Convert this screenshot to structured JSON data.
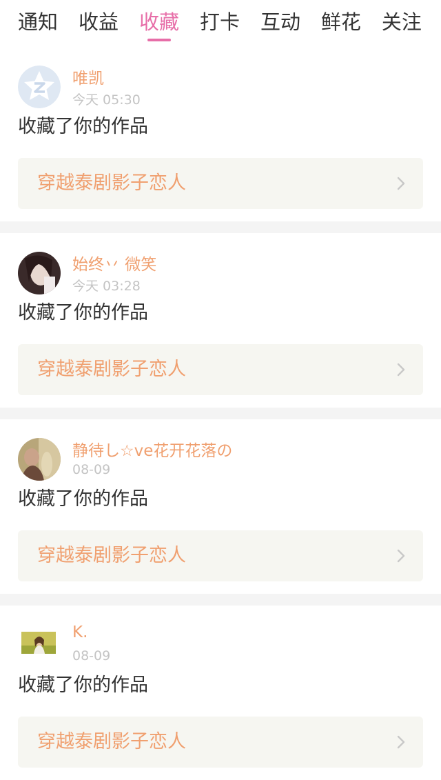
{
  "tabs": [
    {
      "label": "通知",
      "active": false
    },
    {
      "label": "收益",
      "active": false
    },
    {
      "label": "收藏",
      "active": true
    },
    {
      "label": "打卡",
      "active": false
    },
    {
      "label": "互动",
      "active": false
    },
    {
      "label": "鲜花",
      "active": false
    },
    {
      "label": "关注",
      "active": false
    }
  ],
  "colors": {
    "accent": "#e76ea8",
    "name_orange": "#f0a070",
    "time_gray": "#c4c4c4",
    "box_bg": "#f6f6f1",
    "divider": "#f4f4f4"
  },
  "notifications": [
    {
      "avatar": "default-qzone-avatar-icon",
      "username": "唯凯",
      "time": "今天 05:30",
      "action": "收藏了你的作品",
      "work_title": "穿越泰剧影子恋人"
    },
    {
      "avatar": "user-photo-avatar",
      "username": "始终丷 微笑",
      "time": "今天 03:28",
      "action": "收藏了你的作品",
      "work_title": "穿越泰剧影子恋人"
    },
    {
      "avatar": "user-photo-avatar",
      "username": "静待し☆ve花开花落の",
      "time": "08-09",
      "action": "收藏了你的作品",
      "work_title": "穿越泰剧影子恋人"
    },
    {
      "avatar": "user-photo-avatar",
      "username": "K.",
      "time": "08-09",
      "action": "收藏了你的作品",
      "work_title": "穿越泰剧影子恋人"
    }
  ]
}
